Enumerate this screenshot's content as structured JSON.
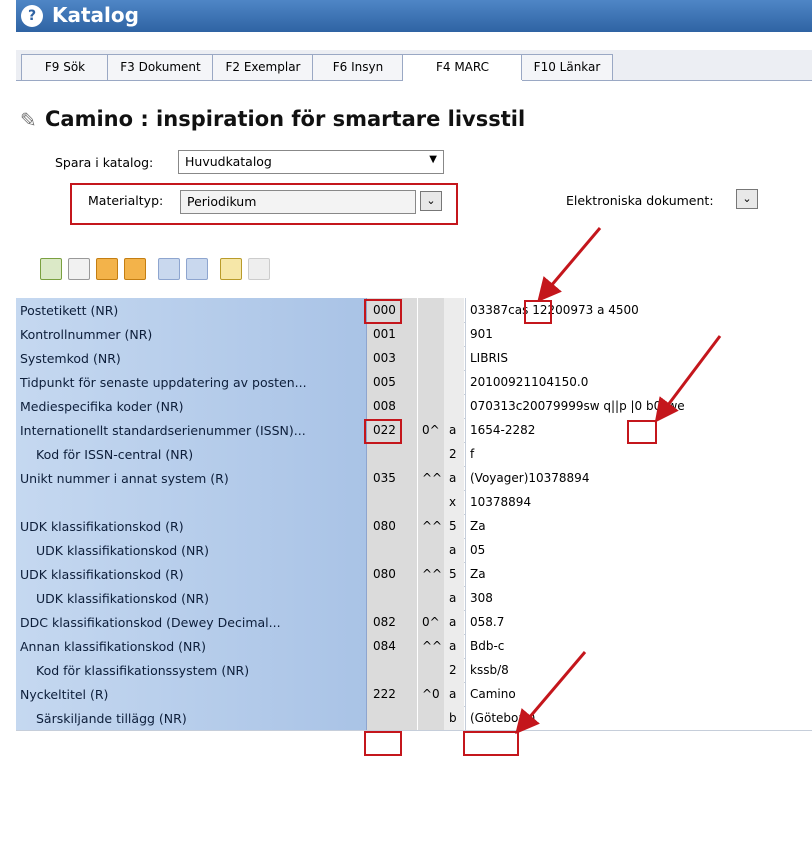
{
  "window": {
    "title": "Katalog",
    "help": "?"
  },
  "tabs": [
    {
      "label": "F9 Sök"
    },
    {
      "label": "F3 Dokument"
    },
    {
      "label": "F2 Exemplar"
    },
    {
      "label": "F6 Insyn"
    },
    {
      "label": "F4 MARC",
      "active": true
    },
    {
      "label": "F10 Länkar"
    }
  ],
  "record": {
    "title": "Camino : inspiration för smartare livsstil"
  },
  "form": {
    "catalog_label": "Spara i katalog:",
    "catalog_value": "Huvudkatalog",
    "material_label": "Materialtyp:",
    "material_value": "Periodikum",
    "electronic_label": "Elektroniska dokument:"
  },
  "toolbar": [
    {
      "icon": "import-record-icon"
    },
    {
      "icon": "new-field-icon"
    },
    {
      "icon": "add-row-icon"
    },
    {
      "icon": "delete-row-icon"
    },
    {
      "icon": "undo-icon"
    },
    {
      "icon": "redo-icon"
    },
    {
      "icon": "sort-fields-icon"
    },
    {
      "icon": "move-field-icon"
    }
  ],
  "marc_rows": [
    {
      "label": "Postetikett (NR)",
      "tag": "000",
      "ind": "",
      "sub": "",
      "value": "03387cas 12200973 a 4500"
    },
    {
      "label": "Kontrollnummer (NR)",
      "tag": "001",
      "ind": "",
      "sub": "",
      "value": "901"
    },
    {
      "label": "Systemkod (NR)",
      "tag": "003",
      "ind": "",
      "sub": "",
      "value": "LIBRIS"
    },
    {
      "label": "Tidpunkt för senaste uppdatering av posten...",
      "tag": "005",
      "ind": "",
      "sub": "",
      "value": "20100921104150.0"
    },
    {
      "label": "Mediespecifika koder (NR)",
      "tag": "008",
      "ind": "",
      "sub": "",
      "value": "070313c20079999sw q||p     |0   b0swe"
    },
    {
      "label": "Internationellt standardserienummer (ISSN)...",
      "tag": "022",
      "ind": "0^",
      "sub": "a",
      "value": "1654-2282"
    },
    {
      "label": "Kod för ISSN-central (NR)",
      "tag": "",
      "ind": "",
      "sub": "2",
      "value": "f",
      "sub_row": true
    },
    {
      "label": "Unikt nummer i annat system (R)",
      "tag": "035",
      "ind": "^^",
      "sub": "a",
      "value": "(Voyager)10378894"
    },
    {
      "label": "",
      "tag": "",
      "ind": "",
      "sub": "x",
      "value": "10378894"
    },
    {
      "label": "UDK klassifikationskod (R)",
      "tag": "080",
      "ind": "^^",
      "sub": "5",
      "value": "Za"
    },
    {
      "label": "UDK klassifikationskod (NR)",
      "tag": "",
      "ind": "",
      "sub": "a",
      "value": "05",
      "sub_row": true
    },
    {
      "label": "UDK klassifikationskod (R)",
      "tag": "080",
      "ind": "^^",
      "sub": "5",
      "value": "Za"
    },
    {
      "label": "UDK klassifikationskod (NR)",
      "tag": "",
      "ind": "",
      "sub": "a",
      "value": "308",
      "sub_row": true
    },
    {
      "label": "DDC klassifikationskod (Dewey Decimal...",
      "tag": "082",
      "ind": "0^",
      "sub": "a",
      "value": "058.7"
    },
    {
      "label": "Annan klassifikationskod (NR)",
      "tag": "084",
      "ind": "^^",
      "sub": "a",
      "value": "Bdb-c"
    },
    {
      "label": "Kod för klassifikationssystem (NR)",
      "tag": "",
      "ind": "",
      "sub": "2",
      "value": "kssb/8",
      "sub_row": true
    },
    {
      "label": "Nyckeltitel (R)",
      "tag": "222",
      "ind": "^0",
      "sub": "a",
      "value": "Camino"
    },
    {
      "label": "Särskiljande tillägg (NR)",
      "tag": "",
      "ind": "",
      "sub": "b",
      "value": "(Göteborg)",
      "sub_row": true
    }
  ]
}
